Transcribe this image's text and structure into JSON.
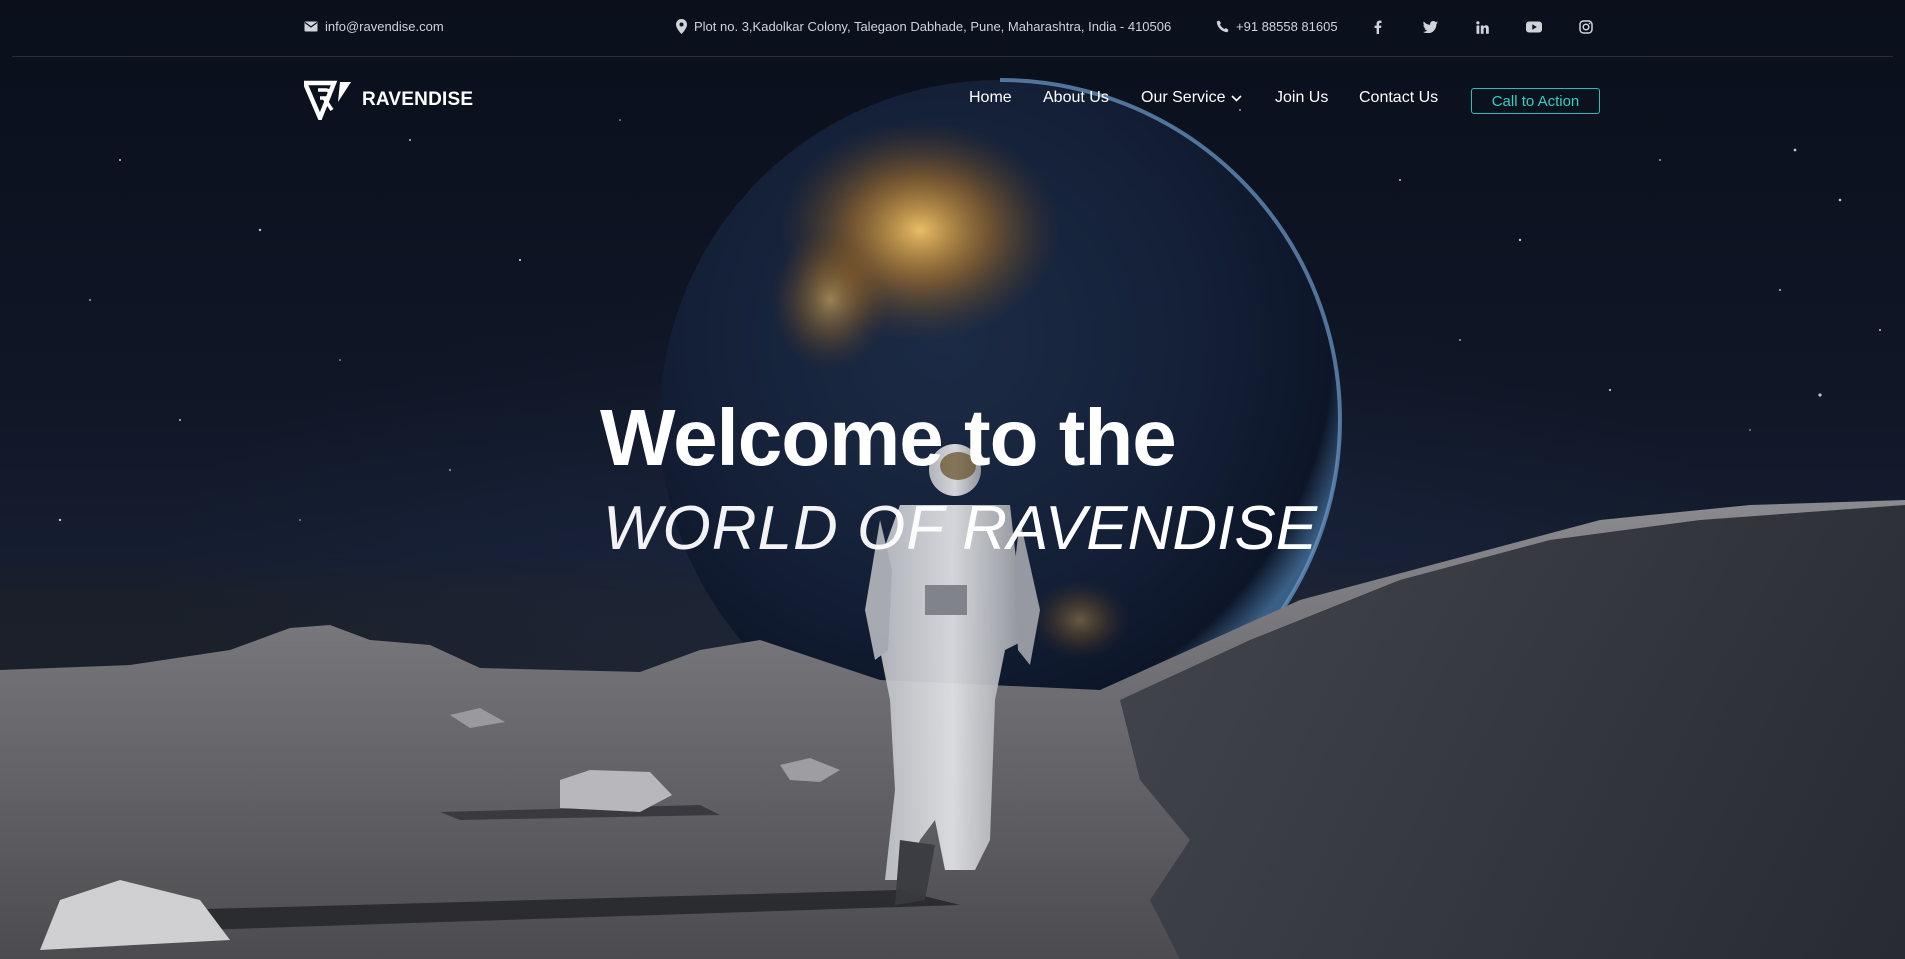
{
  "topbar": {
    "email": "info@ravendise.com",
    "address": "Plot no. 3,Kadolkar Colony, Talegaon Dabhade, Pune, Maharashtra, India - 410506",
    "phone": "+91 88558 81605",
    "social_icons": [
      "facebook-icon",
      "twitter-icon",
      "linkedin-icon",
      "youtube-icon",
      "instagram-icon"
    ]
  },
  "header": {
    "brand": "RAVENDISE",
    "nav": {
      "home": "Home",
      "about": "About Us",
      "service": "Our Service",
      "join": "Join Us",
      "contact": "Contact Us"
    },
    "cta": "Call to Action"
  },
  "hero": {
    "title": "Welcome to the",
    "subtitle_light": "WORLD OF ",
    "subtitle_strong": "RAVENDISE"
  },
  "colors": {
    "accent": "#1ec3b4",
    "background": "#0b101c",
    "text": "#ffffff"
  }
}
